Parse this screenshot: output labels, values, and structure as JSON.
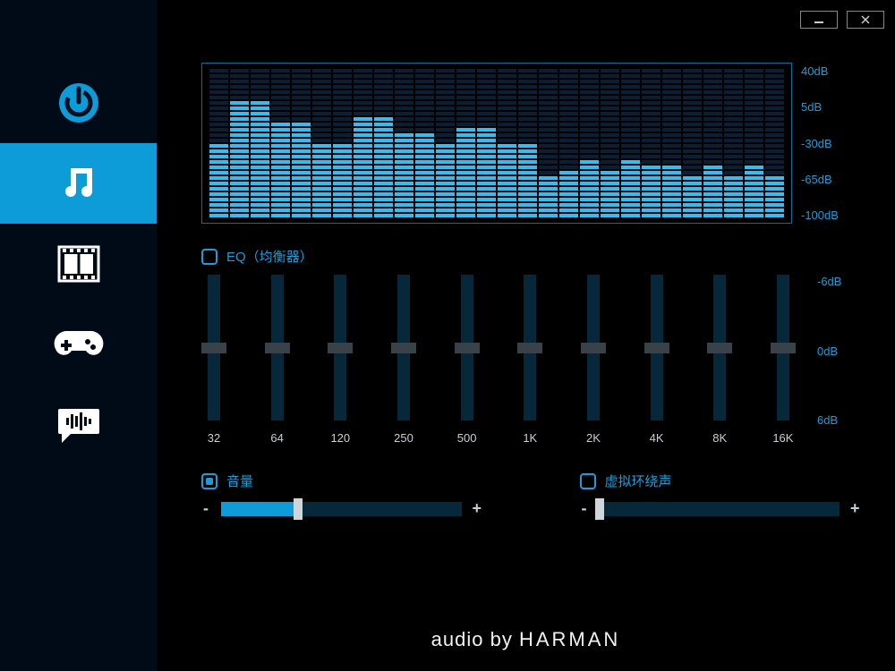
{
  "window": {
    "minimize_tooltip": "Minimize",
    "close_tooltip": "Close"
  },
  "sidebar": {
    "items": [
      {
        "name": "power"
      },
      {
        "name": "music"
      },
      {
        "name": "movie"
      },
      {
        "name": "game"
      },
      {
        "name": "voice"
      }
    ],
    "active_index": 1
  },
  "spectrum": {
    "scale": [
      "40dB",
      "5dB",
      "-30dB",
      "-65dB",
      "-100dB"
    ],
    "num_segments": 28,
    "bars": [
      14,
      22,
      22,
      18,
      18,
      14,
      14,
      19,
      19,
      16,
      16,
      14,
      17,
      17,
      14,
      14,
      8,
      9,
      11,
      9,
      11,
      10,
      10,
      8,
      10,
      8,
      10,
      8
    ]
  },
  "eq": {
    "checkbox_on": false,
    "label": "EQ（均衡器）",
    "scale": [
      "-6dB",
      "0dB",
      "6dB"
    ],
    "freqs": [
      "32",
      "64",
      "120",
      "250",
      "500",
      "1K",
      "2K",
      "4K",
      "8K",
      "16K"
    ]
  },
  "volume": {
    "checkbox_on": true,
    "label": "音量",
    "minus": "-",
    "plus": "+",
    "value_pct": 32
  },
  "surround": {
    "checkbox_on": false,
    "label": "虚拟环绕声",
    "minus": "-",
    "plus": "+",
    "value_pct": 0
  },
  "footer": {
    "prefix": "audio by ",
    "brand": "HARMAN"
  }
}
